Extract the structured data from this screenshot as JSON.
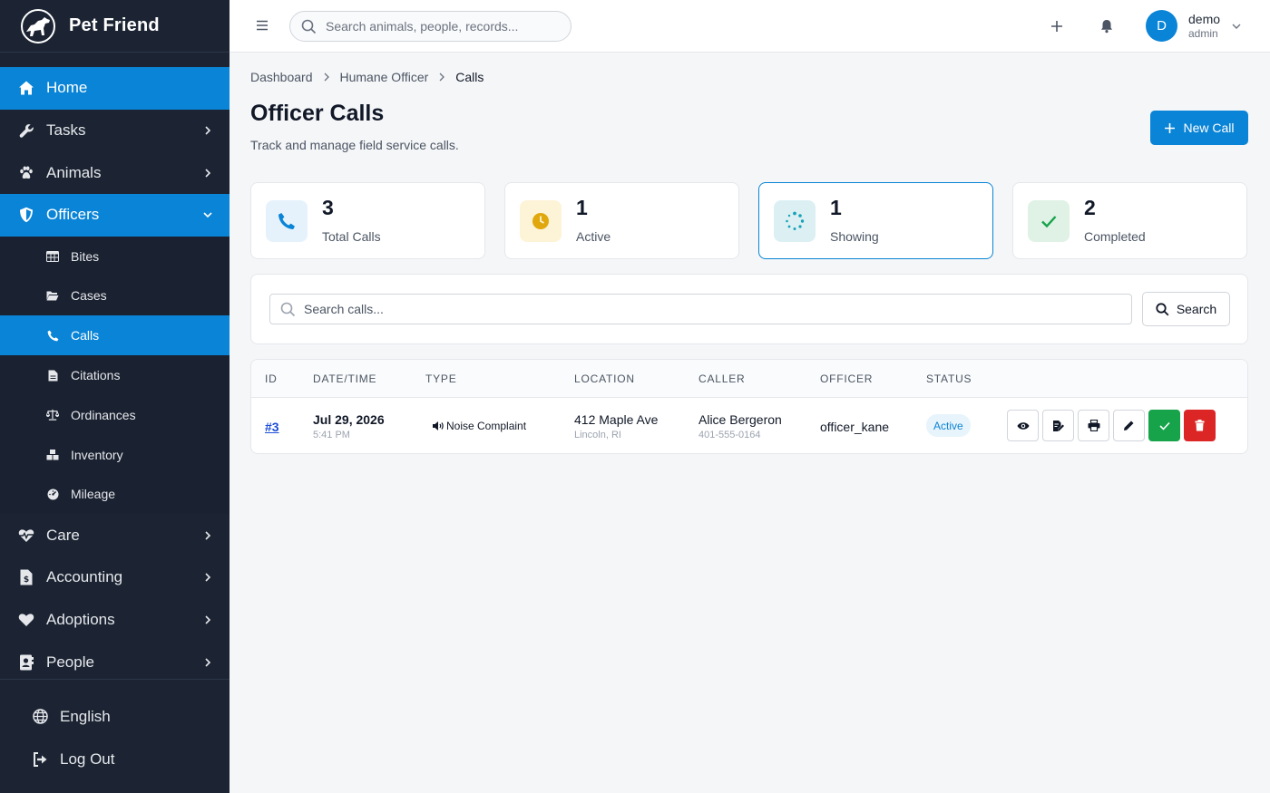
{
  "brand": {
    "name": "Pet Friend"
  },
  "sidebar": {
    "items": [
      {
        "label": "Home",
        "icon": "home-icon",
        "active": true
      },
      {
        "label": "Tasks",
        "icon": "wrench-icon"
      },
      {
        "label": "Animals",
        "icon": "paw-icon"
      },
      {
        "label": "Officers",
        "icon": "shield-icon",
        "expanded": true
      }
    ],
    "sub_items": [
      {
        "label": "Bites",
        "icon": "table-icon"
      },
      {
        "label": "Cases",
        "icon": "folder-icon"
      },
      {
        "label": "Calls",
        "icon": "phone-icon",
        "active": true
      },
      {
        "label": "Citations",
        "icon": "document-icon"
      },
      {
        "label": "Ordinances",
        "icon": "scale-icon"
      },
      {
        "label": "Inventory",
        "icon": "boxes-icon"
      },
      {
        "label": "Mileage",
        "icon": "gauge-icon"
      }
    ],
    "items_after": [
      {
        "label": "Care",
        "icon": "heartbeat-icon"
      },
      {
        "label": "Accounting",
        "icon": "invoice-icon"
      },
      {
        "label": "Adoptions",
        "icon": "heart-icon"
      },
      {
        "label": "People",
        "icon": "contact-icon"
      }
    ],
    "footer": [
      {
        "label": "English",
        "icon": "globe-icon"
      },
      {
        "label": "Log Out",
        "icon": "logout-icon"
      }
    ]
  },
  "topbar": {
    "search_placeholder": "Search animals, people, records...",
    "user_initial": "D",
    "user_name": "demo",
    "user_role": "admin"
  },
  "breadcrumb": [
    "Dashboard",
    "Humane Officer",
    "Calls"
  ],
  "page": {
    "title": "Officer Calls",
    "subtitle": "Track and manage field service calls.",
    "new_button": "New Call"
  },
  "stats": [
    {
      "value": "3",
      "label": "Total Calls",
      "icon": "phone-icon",
      "color": "#0a84d6"
    },
    {
      "value": "1",
      "label": "Active",
      "icon": "clock-icon",
      "color": "#e0a80d"
    },
    {
      "value": "1",
      "label": "Showing",
      "icon": "spinner-icon",
      "color": "#17a2b8"
    },
    {
      "value": "2",
      "label": "Completed",
      "icon": "check-icon",
      "color": "#16a34a"
    }
  ],
  "calls_search": {
    "placeholder": "Search calls...",
    "button": "Search"
  },
  "table": {
    "headers": [
      "ID",
      "DATE/TIME",
      "TYPE",
      "LOCATION",
      "CALLER",
      "OFFICER",
      "STATUS"
    ],
    "rows": [
      {
        "id": "#3",
        "date": "Jul 29, 2026",
        "time": "5:41 PM",
        "type": "Noise Complaint",
        "location": "412 Maple Ave",
        "city": "Lincoln, RI",
        "caller": "Alice Bergeron",
        "phone": "401-555-0164",
        "officer": "officer_kane",
        "status": "Active"
      }
    ]
  },
  "colors": {
    "accent": "#0a84d6",
    "sidebar": "#1c2433",
    "success": "#16a34a",
    "danger": "#dc2626"
  }
}
